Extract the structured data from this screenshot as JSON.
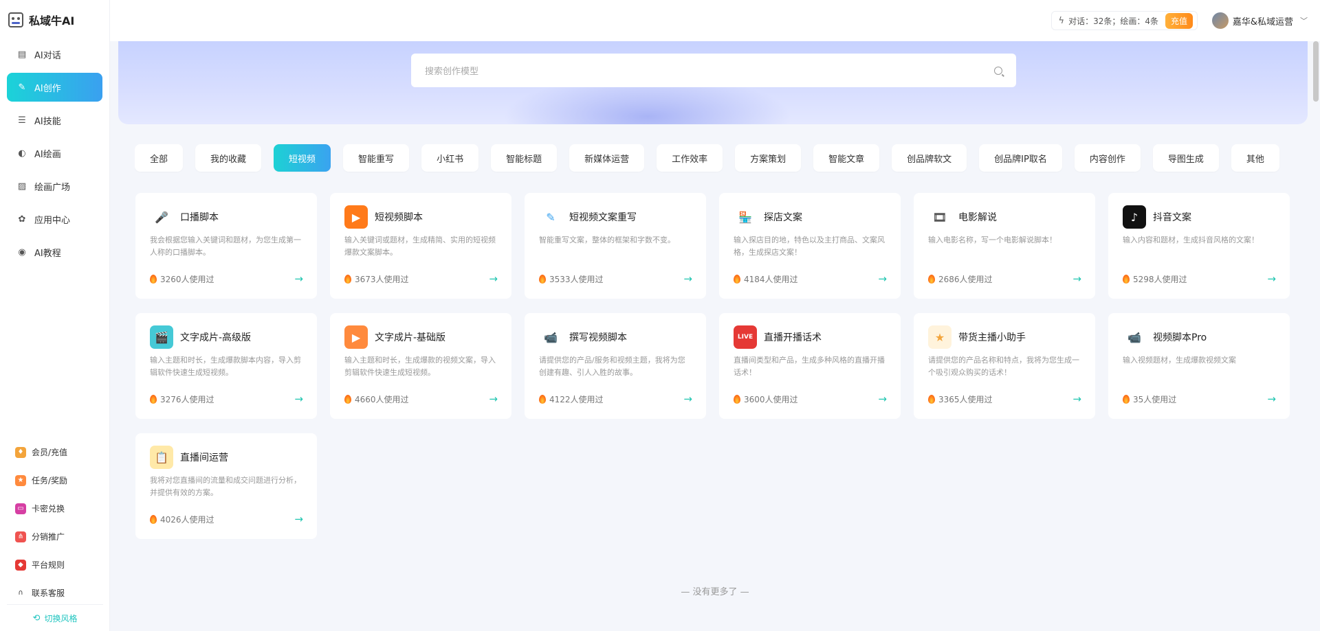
{
  "app": {
    "name": "私域牛AI"
  },
  "sidebar": {
    "items": [
      {
        "label": "AI对话",
        "icon": "chat-icon"
      },
      {
        "label": "AI创作",
        "icon": "pen-icon",
        "active": true
      },
      {
        "label": "AI技能",
        "icon": "list-icon"
      },
      {
        "label": "AI绘画",
        "icon": "palette-icon"
      },
      {
        "label": "绘画广场",
        "icon": "image-icon"
      },
      {
        "label": "应用中心",
        "icon": "gear-icon"
      },
      {
        "label": "AI教程",
        "icon": "tutorial-icon"
      }
    ],
    "bottom": [
      {
        "label": "会员/充值",
        "icon": "vip-icon",
        "color": "#f3a43b"
      },
      {
        "label": "任务/奖励",
        "icon": "task-icon",
        "color": "#ff8a3d"
      },
      {
        "label": "卡密兑换",
        "icon": "card-icon",
        "color": "#d63fa3"
      },
      {
        "label": "分销推广",
        "icon": "share-icon",
        "color": "#ef5350"
      },
      {
        "label": "平台规则",
        "icon": "rules-icon",
        "color": "#e53935"
      },
      {
        "label": "联系客服",
        "icon": "headset-icon",
        "color": "#333333"
      }
    ],
    "switch_theme": "切换风格"
  },
  "topbar": {
    "quota": "对话：32条；绘画：4条",
    "recharge": "充值",
    "user": "嘉华&私域运营"
  },
  "search": {
    "placeholder": "搜索创作模型"
  },
  "tabs": [
    "全部",
    "我的收藏",
    "短视频",
    "智能重写",
    "小红书",
    "智能标题",
    "新媒体运营",
    "工作效率",
    "方案策划",
    "智能文章",
    "创品牌软文",
    "创品牌IP取名",
    "内容创作",
    "导图生成",
    "其他"
  ],
  "active_tab": "短视频",
  "cards": [
    {
      "title": "口播脚本",
      "desc": "我会根据您输入关键词和题材，为您生成第一人称的口播脚本。",
      "usage": "3260人使用过",
      "icon": "microphone-icon",
      "bg": "#ffffff",
      "fg": "#4a63c8",
      "glyph": "🎤"
    },
    {
      "title": "短视频脚本",
      "desc": "输入关键词或题材，生成精简、实用的短视频爆款文案脚本。",
      "usage": "3673人使用过",
      "icon": "video-play-icon",
      "bg": "#ff7a1a",
      "fg": "#ffffff",
      "glyph": "▶"
    },
    {
      "title": "短视频文案重写",
      "desc": "智能重写文案，整体的框架和字数不变。",
      "usage": "3533人使用过",
      "icon": "eraser-icon",
      "bg": "#ffffff",
      "fg": "#3aa3f0",
      "glyph": "✎"
    },
    {
      "title": "探店文案",
      "desc": "输入探店目的地，特色以及主打商品、文案风格，生成探店文案！",
      "usage": "4184人使用过",
      "icon": "store-icon",
      "bg": "#ffffff",
      "fg": "#e8543b",
      "glyph": "🏪"
    },
    {
      "title": "电影解说",
      "desc": "输入电影名称，写一个电影解说脚本！",
      "usage": "2686人使用过",
      "icon": "film-icon",
      "bg": "#ffffff",
      "fg": "#555555",
      "glyph": "🎞"
    },
    {
      "title": "抖音文案",
      "desc": "输入内容和题材，生成抖音风格的文案！",
      "usage": "5298人使用过",
      "icon": "tiktok-icon",
      "bg": "#111111",
      "fg": "#ffffff",
      "glyph": "♪"
    },
    {
      "title": "文字成片-高级版",
      "desc": "输入主题和时长，生成爆款脚本内容，导入剪辑软件快速生成短视频。",
      "usage": "3276人使用过",
      "icon": "clapper-icon",
      "bg": "#45c9d6",
      "fg": "#ffffff",
      "glyph": "🎬"
    },
    {
      "title": "文字成片-基础版",
      "desc": "输入主题和时长，生成爆款的视频文案，导入剪辑软件快速生成短视频。",
      "usage": "4660人使用过",
      "icon": "video-file-icon",
      "bg": "#ff8a3d",
      "fg": "#ffffff",
      "glyph": "▶"
    },
    {
      "title": "撰写视频脚本",
      "desc": "请提供您的产品/服务和视频主题，我将为您创建有趣、引人入胜的故事。",
      "usage": "4122人使用过",
      "icon": "camera-icon",
      "bg": "#ffffff",
      "fg": "#3ab0e0",
      "glyph": "📹"
    },
    {
      "title": "直播开播话术",
      "desc": "直播间类型和产品，生成多种风格的直播开播话术！",
      "usage": "3600人使用过",
      "icon": "live-icon",
      "bg": "#e53935",
      "fg": "#ffffff",
      "glyph": "LIVE"
    },
    {
      "title": "带货主播小助手",
      "desc": "请提供您的产品名称和特点，我将为您生成一个吸引观众购买的话术！",
      "usage": "3365人使用过",
      "icon": "star-icon",
      "bg": "#fff3dc",
      "fg": "#f3a43b",
      "glyph": "★"
    },
    {
      "title": "视频脚本Pro",
      "desc": "输入视频题材，生成爆款视频文案",
      "usage": "35人使用过",
      "icon": "video-camera-icon",
      "bg": "#ffffff",
      "fg": "#3ab0e0",
      "glyph": "📹"
    },
    {
      "title": "直播间运营",
      "desc": "我将对您直播间的流量和成交问题进行分析，并提供有效的方案。",
      "usage": "4026人使用过",
      "icon": "clipboard-icon",
      "bg": "#ffe9a8",
      "fg": "#333333",
      "glyph": "📋"
    }
  ],
  "footer": {
    "no_more": "— 没有更多了 —"
  }
}
